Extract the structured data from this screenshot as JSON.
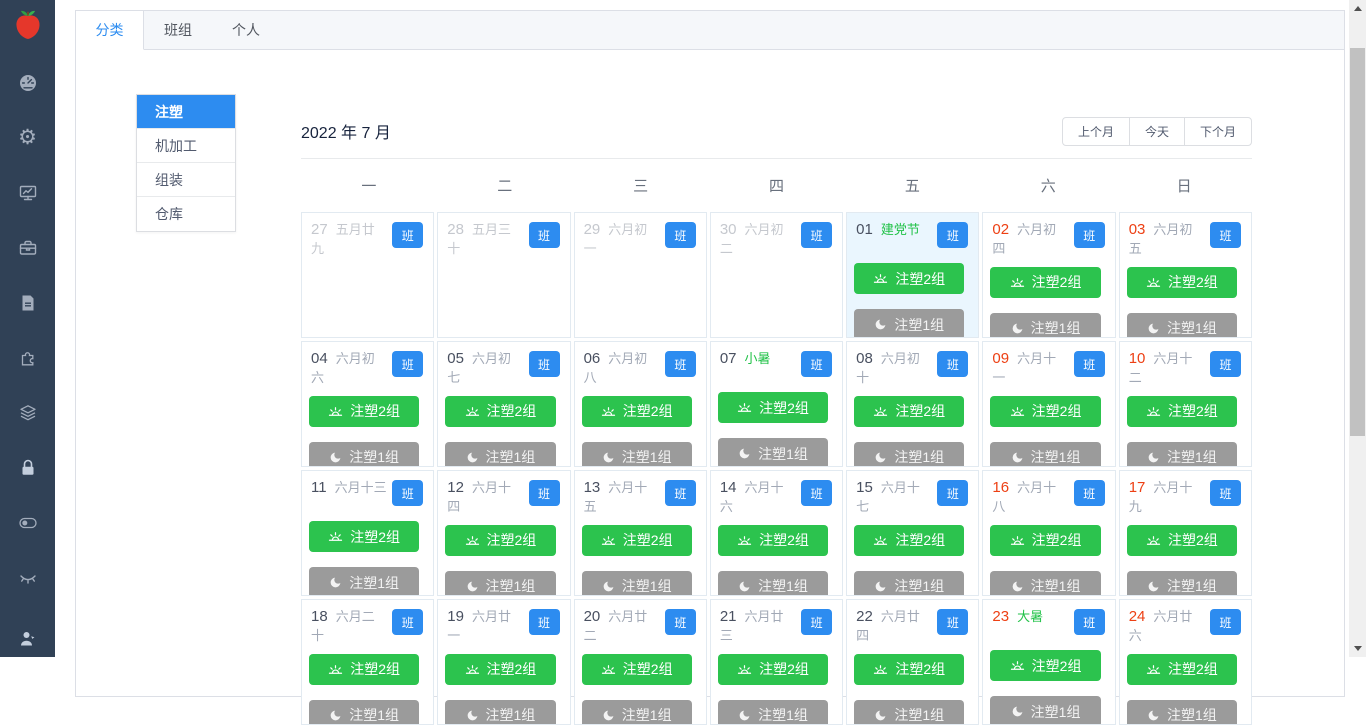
{
  "sidebar": {
    "logo": "red-pepper-logo",
    "icons": [
      "dashboard",
      "settings",
      "monitor-chart",
      "briefcase",
      "document",
      "plugin",
      "layers",
      "lock",
      "toggle",
      "eye-off",
      "user"
    ]
  },
  "tabs": [
    {
      "label": "分类",
      "active": true
    },
    {
      "label": "班组",
      "active": false
    },
    {
      "label": "个人",
      "active": false
    }
  ],
  "categories": [
    {
      "label": "注塑",
      "active": true
    },
    {
      "label": "机加工",
      "active": false
    },
    {
      "label": "组装",
      "active": false
    },
    {
      "label": "仓库",
      "active": false
    }
  ],
  "calendar": {
    "title": "2022 年 7 月",
    "nav": [
      {
        "label": "上个月"
      },
      {
        "label": "今天"
      },
      {
        "label": "下个月"
      }
    ],
    "weekdays": [
      "一",
      "二",
      "三",
      "四",
      "五",
      "六",
      "日"
    ],
    "badge_label": "班",
    "day_shift_label": "注塑2组",
    "night_shift_label": "注塑1组",
    "day_shift_icon": "sunrise-icon",
    "night_shift_icon": "moon-icon",
    "cells": [
      {
        "day": "27",
        "lunar": "五月廿九",
        "day_type": "prev",
        "lunar_type": "normal",
        "shifts": false,
        "highlight": false
      },
      {
        "day": "28",
        "lunar": "五月三十",
        "day_type": "prev",
        "lunar_type": "normal",
        "shifts": false,
        "highlight": false
      },
      {
        "day": "29",
        "lunar": "六月初一",
        "day_type": "prev",
        "lunar_type": "normal",
        "shifts": false,
        "highlight": false
      },
      {
        "day": "30",
        "lunar": "六月初二",
        "day_type": "prev",
        "lunar_type": "normal",
        "shifts": false,
        "highlight": false
      },
      {
        "day": "01",
        "lunar": "建党节",
        "day_type": "workday",
        "lunar_type": "holiday",
        "shifts": true,
        "highlight": true
      },
      {
        "day": "02",
        "lunar": "六月初四",
        "day_type": "weekend",
        "lunar_type": "normal",
        "shifts": true,
        "highlight": false
      },
      {
        "day": "03",
        "lunar": "六月初五",
        "day_type": "weekend",
        "lunar_type": "normal",
        "shifts": true,
        "highlight": false
      },
      {
        "day": "04",
        "lunar": "六月初六",
        "day_type": "workday",
        "lunar_type": "normal",
        "shifts": true,
        "highlight": false
      },
      {
        "day": "05",
        "lunar": "六月初七",
        "day_type": "workday",
        "lunar_type": "normal",
        "shifts": true,
        "highlight": false
      },
      {
        "day": "06",
        "lunar": "六月初八",
        "day_type": "workday",
        "lunar_type": "normal",
        "shifts": true,
        "highlight": false
      },
      {
        "day": "07",
        "lunar": "小暑",
        "day_type": "workday",
        "lunar_type": "holiday",
        "shifts": true,
        "highlight": false
      },
      {
        "day": "08",
        "lunar": "六月初十",
        "day_type": "workday",
        "lunar_type": "normal",
        "shifts": true,
        "highlight": false
      },
      {
        "day": "09",
        "lunar": "六月十一",
        "day_type": "weekend",
        "lunar_type": "normal",
        "shifts": true,
        "highlight": false
      },
      {
        "day": "10",
        "lunar": "六月十二",
        "day_type": "weekend",
        "lunar_type": "normal",
        "shifts": true,
        "highlight": false
      },
      {
        "day": "11",
        "lunar": "六月十三",
        "day_type": "workday",
        "lunar_type": "normal",
        "shifts": true,
        "highlight": false
      },
      {
        "day": "12",
        "lunar": "六月十四",
        "day_type": "workday",
        "lunar_type": "normal",
        "shifts": true,
        "highlight": false
      },
      {
        "day": "13",
        "lunar": "六月十五",
        "day_type": "workday",
        "lunar_type": "normal",
        "shifts": true,
        "highlight": false
      },
      {
        "day": "14",
        "lunar": "六月十六",
        "day_type": "workday",
        "lunar_type": "normal",
        "shifts": true,
        "highlight": false
      },
      {
        "day": "15",
        "lunar": "六月十七",
        "day_type": "workday",
        "lunar_type": "normal",
        "shifts": true,
        "highlight": false
      },
      {
        "day": "16",
        "lunar": "六月十八",
        "day_type": "weekend",
        "lunar_type": "normal",
        "shifts": true,
        "highlight": false
      },
      {
        "day": "17",
        "lunar": "六月十九",
        "day_type": "weekend",
        "lunar_type": "normal",
        "shifts": true,
        "highlight": false
      },
      {
        "day": "18",
        "lunar": "六月二十",
        "day_type": "workday",
        "lunar_type": "normal",
        "shifts": true,
        "highlight": false
      },
      {
        "day": "19",
        "lunar": "六月廿一",
        "day_type": "workday",
        "lunar_type": "normal",
        "shifts": true,
        "highlight": false
      },
      {
        "day": "20",
        "lunar": "六月廿二",
        "day_type": "workday",
        "lunar_type": "normal",
        "shifts": true,
        "highlight": false
      },
      {
        "day": "21",
        "lunar": "六月廿三",
        "day_type": "workday",
        "lunar_type": "normal",
        "shifts": true,
        "highlight": false
      },
      {
        "day": "22",
        "lunar": "六月廿四",
        "day_type": "workday",
        "lunar_type": "normal",
        "shifts": true,
        "highlight": false
      },
      {
        "day": "23",
        "lunar": "大暑",
        "day_type": "weekend",
        "lunar_type": "holiday",
        "shifts": true,
        "highlight": false
      },
      {
        "day": "24",
        "lunar": "六月廿六",
        "day_type": "weekend",
        "lunar_type": "normal",
        "shifts": true,
        "highlight": false
      }
    ]
  },
  "colors": {
    "primary": "#2d8cf0",
    "day_shift_green": "#2cc34e",
    "night_shift_gray": "#9b9b9b",
    "weekend_red": "#ed4014",
    "holiday_green": "#21c248",
    "sidebar_bg": "#304156",
    "highlight_cell_bg": "#eaf6fe"
  }
}
